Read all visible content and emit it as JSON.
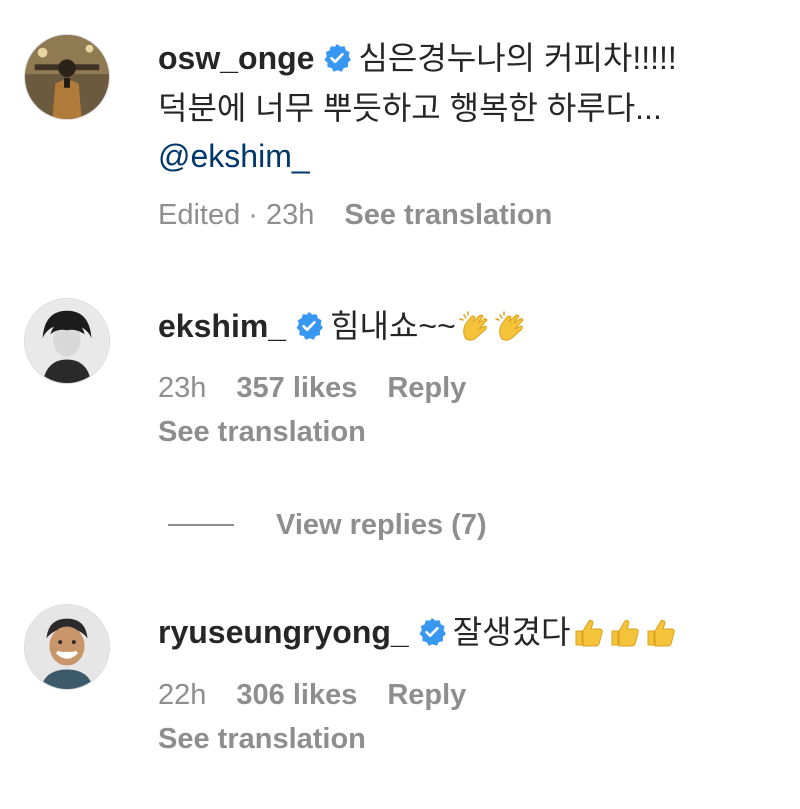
{
  "comments": [
    {
      "username": "osw_onge",
      "text_line1": "심은경누나의 커피차!!!!!",
      "text_line2": "덕분에 너무 뿌듯하고 행복한 하루다...",
      "mention": "@ekshim_",
      "meta_edited": "Edited · 23h",
      "meta_translate": "See translation"
    },
    {
      "username": "ekshim_",
      "text": "힘내쇼~~",
      "emojis": [
        "clapping-hands",
        "clapping-hands"
      ],
      "time": "23h",
      "likes": "357 likes",
      "reply": "Reply",
      "translate": "See translation"
    },
    {
      "username": "ryuseungryong_",
      "text": "잘생겼다",
      "emojis": [
        "thumbs-up",
        "thumbs-up",
        "thumbs-up"
      ],
      "time": "22h",
      "likes": "306 likes",
      "reply": "Reply",
      "translate": "See translation"
    }
  ],
  "view_replies": "View replies (7)",
  "colors": {
    "verified": "#3897f0",
    "mention": "#00376b",
    "muted": "#8e8e8e",
    "text": "#262626"
  }
}
